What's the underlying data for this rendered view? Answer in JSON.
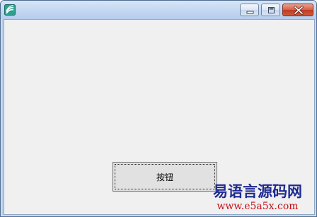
{
  "window": {
    "title": "",
    "icon": "app-icon",
    "buttons": [
      "minimize-icon",
      "maximize-icon",
      "close-icon"
    ]
  },
  "form": {
    "button_label": "按钮"
  },
  "watermark": {
    "text": "易语言源码网",
    "url": "www.e5a5x.com"
  },
  "colors": {
    "client_bg": "#f0f0f0",
    "close_red": "#c23a21",
    "watermark_blue": "#1e2a8f",
    "watermark_red": "#c4121a"
  }
}
